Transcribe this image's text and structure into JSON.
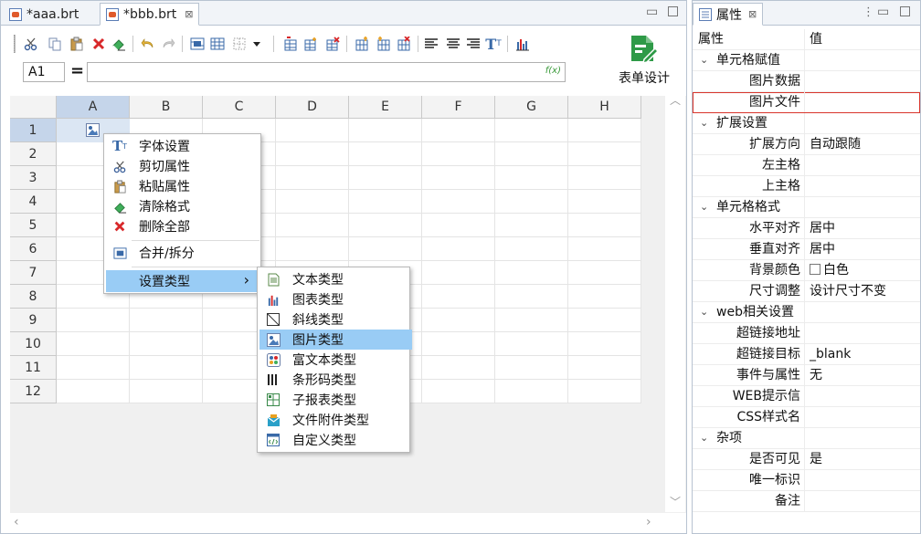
{
  "tabs": [
    {
      "label": "*aaa.brt"
    },
    {
      "label": "*bbb.brt"
    }
  ],
  "formula_bar": {
    "cell_ref": "A1",
    "equals": "=",
    "fx": "f(x)",
    "value": ""
  },
  "design_button": {
    "label": "表单设计"
  },
  "grid": {
    "columns": [
      "A",
      "B",
      "C",
      "D",
      "E",
      "F",
      "G",
      "H"
    ],
    "rows": [
      "1",
      "2",
      "3",
      "4",
      "5",
      "6",
      "7",
      "8",
      "9",
      "10",
      "11",
      "12"
    ],
    "selected_cell": "A1"
  },
  "context_menu": {
    "items": [
      {
        "label": "字体设置",
        "icon": "font-icon"
      },
      {
        "label": "剪切属性",
        "icon": "scissors-icon"
      },
      {
        "label": "粘贴属性",
        "icon": "paste-icon"
      },
      {
        "label": "清除格式",
        "icon": "eraser-icon"
      },
      {
        "label": "删除全部",
        "icon": "delete-x-icon"
      },
      {
        "label": "合并/拆分",
        "icon": "merge-icon"
      },
      {
        "label": "设置类型",
        "icon": "",
        "arrow": "›"
      }
    ]
  },
  "submenu": {
    "items": [
      {
        "label": "文本类型",
        "icon": "text-doc-icon"
      },
      {
        "label": "图表类型",
        "icon": "bar-chart-icon"
      },
      {
        "label": "斜线类型",
        "icon": "diagonal-icon"
      },
      {
        "label": "图片类型",
        "icon": "image-icon"
      },
      {
        "label": "富文本类型",
        "icon": "rich-text-icon"
      },
      {
        "label": "条形码类型",
        "icon": "barcode-icon"
      },
      {
        "label": "子报表类型",
        "icon": "subreport-icon"
      },
      {
        "label": "文件附件类型",
        "icon": "attachment-icon"
      },
      {
        "label": "自定义类型",
        "icon": "custom-icon"
      }
    ]
  },
  "properties": {
    "tab_label": "属性",
    "header": {
      "name": "属性",
      "value": "值"
    },
    "rows": [
      {
        "kind": "cat",
        "name": "单元格赋值",
        "value": ""
      },
      {
        "kind": "child",
        "name": "图片数据",
        "value": ""
      },
      {
        "kind": "child",
        "name": "图片文件",
        "value": "",
        "focus": true
      },
      {
        "kind": "cat",
        "name": "扩展设置",
        "value": ""
      },
      {
        "kind": "child",
        "name": "扩展方向",
        "value": "自动跟随"
      },
      {
        "kind": "child",
        "name": "左主格",
        "value": ""
      },
      {
        "kind": "child",
        "name": "上主格",
        "value": ""
      },
      {
        "kind": "cat",
        "name": "单元格格式",
        "value": ""
      },
      {
        "kind": "child",
        "name": "水平对齐",
        "value": "居中"
      },
      {
        "kind": "child",
        "name": "垂直对齐",
        "value": "居中"
      },
      {
        "kind": "child",
        "name": "背景颜色",
        "value": "白色",
        "swatch": true
      },
      {
        "kind": "child",
        "name": "尺寸调整",
        "value": "设计尺寸不变"
      },
      {
        "kind": "cat",
        "name": "web相关设置",
        "value": ""
      },
      {
        "kind": "child",
        "name": "超链接地址",
        "value": ""
      },
      {
        "kind": "child",
        "name": "超链接目标",
        "value": "_blank"
      },
      {
        "kind": "child",
        "name": "事件与属性",
        "value": "无"
      },
      {
        "kind": "child",
        "name": "WEB提示信",
        "value": ""
      },
      {
        "kind": "child",
        "name": "CSS样式名",
        "value": ""
      },
      {
        "kind": "cat",
        "name": "杂项",
        "value": ""
      },
      {
        "kind": "child",
        "name": "是否可见",
        "value": "是"
      },
      {
        "kind": "child",
        "name": "唯一标识",
        "value": ""
      },
      {
        "kind": "child",
        "name": "备注",
        "value": ""
      }
    ]
  },
  "colors": {
    "accent": "#99ccf5",
    "selection": "#c5d5ea",
    "design_green": "#2e9a47",
    "focus_red": "#d9352c"
  }
}
